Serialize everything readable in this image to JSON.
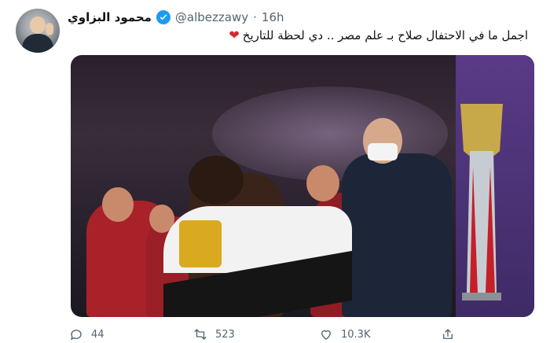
{
  "user": {
    "display_name": "محمود البزاوي",
    "handle": "@albezzawy",
    "separator": "·",
    "time": "16h"
  },
  "tweet": {
    "text": "اجمل ما في الاحتفال صلاح بـ علم مصر .. دي لحظة للتاريخ",
    "emoji": "❤"
  },
  "icons": {
    "verified": "verified-badge-icon",
    "heart_emoji": "heart-emoji-icon",
    "reply": "reply-icon",
    "retweet": "retweet-icon",
    "like": "like-icon",
    "share": "share-icon"
  },
  "actions": {
    "replies": "44",
    "retweets": "523",
    "likes": "10.3K"
  },
  "colors": {
    "accent": "#1d9bf0",
    "heart": "#d12b2b",
    "muted": "#536471"
  }
}
